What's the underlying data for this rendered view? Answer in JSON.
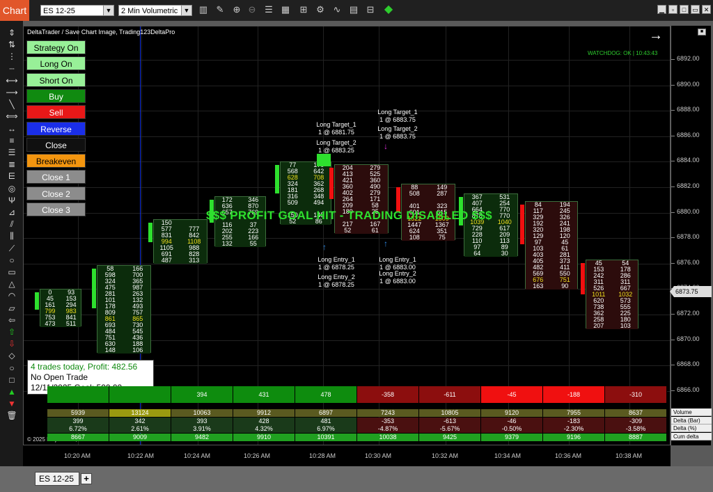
{
  "titlebar": {
    "tab_label": "Chart",
    "instrument": "ES 12-25",
    "period": "2 Min Volumetric",
    "toolbar_icons": [
      "bars-icon",
      "pencil-icon",
      "zoom-in-icon",
      "zoom-out-icon",
      "properties-icon",
      "data-box-icon",
      "templates-icon",
      "strategy-icon",
      "indicators-icon",
      "calendar-icon",
      "chart-trader-icon"
    ],
    "window_buttons": [
      "minimize-icon",
      "maximize-icon",
      "close-icon"
    ]
  },
  "chart": {
    "header": "DeltaTrader / Save Chart Image, Trading123DeltaPro",
    "watchdog": "WATCHDOG: OK | 10:43:43",
    "banner": "$$$ PROFIT GOAL HIT - TRADING DISABLED $$$",
    "copyright": "© 2025 NinjaTrader, LLC",
    "info_box": {
      "line1": "4 trades today, Profit: 482.56",
      "line2": "No Open Trade",
      "line3": "12/11/2025 Goal: 500.00"
    },
    "strategy_buttons": [
      {
        "label": "Strategy On",
        "bg": "#98f098"
      },
      {
        "label": "Long On",
        "bg": "#98f098"
      },
      {
        "label": "Short On",
        "bg": "#98f098"
      },
      {
        "label": "Buy",
        "bg": "#108a10"
      },
      {
        "label": "Sell",
        "bg": "#e81818"
      },
      {
        "label": "Reverse",
        "bg": "#1a2ee8"
      },
      {
        "label": "Close",
        "bg": "#101010"
      },
      {
        "label": "Breakeven",
        "bg": "#f3950f"
      },
      {
        "label": "Close 1",
        "bg": "#8c8c8c"
      },
      {
        "label": "Close 2",
        "bg": "#8c8c8c"
      },
      {
        "label": "Close 3",
        "bg": "#8c8c8c"
      }
    ],
    "orders": [
      {
        "l1": "Long Target_1",
        "l2": "1 @ 6881.75"
      },
      {
        "l1": "Long Target_2",
        "l2": "1 @ 6883.25"
      },
      {
        "l1": "Long Entry_1",
        "l2": "1 @ 6878.25"
      },
      {
        "l1": "Long Entry_2",
        "l2": "1 @ 6878.25"
      },
      {
        "l1": "Long Target_1",
        "l2": "1 @ 6883.75"
      },
      {
        "l1": "Long Target_2",
        "l2": "1 @ 6883.75"
      },
      {
        "l1": "Long Entry_1",
        "l2": "1 @ 6883.00"
      },
      {
        "l1": "Long Entry_2",
        "l2": "1 @ 6883.00"
      }
    ]
  },
  "price_axis": {
    "ticks": [
      "6892.00",
      "6890.00",
      "6888.00",
      "6886.00",
      "6884.00",
      "6882.00",
      "6880.00",
      "6878.00",
      "6876.00",
      "6874.00",
      "6872.00",
      "6870.00",
      "6868.00",
      "6866.00"
    ],
    "current_price": "6873.75"
  },
  "time_axis": [
    "10:20 AM",
    "10:22 AM",
    "10:24 AM",
    "10:26 AM",
    "10:28 AM",
    "10:30 AM",
    "10:32 AM",
    "10:34 AM",
    "10:36 AM",
    "10:38 AM"
  ],
  "candles": [
    {
      "bull": true,
      "rows": [
        [
          "0",
          "93"
        ],
        [
          "45",
          "153"
        ],
        [
          "161",
          "294"
        ],
        [
          "799",
          "983"
        ],
        [
          "753",
          "841"
        ],
        [
          "473",
          "511"
        ]
      ],
      "poc": 3
    },
    {
      "bull": true,
      "rows": [
        [
          "58",
          "166"
        ],
        [
          "598",
          "700"
        ],
        [
          "324",
          "365"
        ],
        [
          "475",
          "987"
        ],
        [
          "281",
          "263"
        ],
        [
          "101",
          "132"
        ],
        [
          "178",
          "493"
        ],
        [
          "809",
          "757"
        ],
        [
          "861",
          "865"
        ],
        [
          "693",
          "730"
        ],
        [
          "484",
          "545"
        ],
        [
          "751",
          "436"
        ],
        [
          "630",
          "188"
        ],
        [
          "148",
          "106"
        ]
      ],
      "poc": 8
    },
    {
      "bull": true,
      "rows": [
        [
          "150",
          ""
        ],
        [
          "577",
          "777"
        ],
        [
          "831",
          "842"
        ],
        [
          "994",
          "1108"
        ],
        [
          "1105",
          "988"
        ],
        [
          "691",
          "828"
        ],
        [
          "487",
          "313"
        ]
      ],
      "poc": 3
    },
    {
      "bull": true,
      "rows": [
        [
          "172",
          "346"
        ],
        [
          "636",
          "870"
        ],
        [
          "657",
          "769"
        ],
        [
          "",
          ""
        ],
        [
          "116",
          "37"
        ],
        [
          "202",
          "223"
        ],
        [
          "255",
          "166"
        ],
        [
          "132",
          "55"
        ]
      ],
      "poc": -1
    },
    {
      "bull": true,
      "rows": [
        [
          "77",
          "170"
        ],
        [
          "568",
          "642"
        ],
        [
          "628",
          "708"
        ],
        [
          "324",
          "362"
        ],
        [
          "181",
          "268"
        ],
        [
          "316",
          "348"
        ],
        [
          "509",
          "494"
        ],
        [
          "",
          ""
        ],
        [
          "150",
          "145"
        ],
        [
          "52",
          "86"
        ]
      ],
      "poc": 2
    },
    {
      "bull": false,
      "rows": [
        [
          "204",
          "279"
        ],
        [
          "413",
          "525"
        ],
        [
          "421",
          "360"
        ],
        [
          "360",
          "490"
        ],
        [
          "402",
          "279"
        ],
        [
          "264",
          "171"
        ],
        [
          "209",
          "58"
        ],
        [
          "189",
          "25"
        ],
        [
          "",
          ""
        ],
        [
          "217",
          "167"
        ],
        [
          "52",
          "61"
        ]
      ],
      "poc": -1
    },
    {
      "bull": false,
      "rows": [
        [
          "88",
          "149"
        ],
        [
          "508",
          "287"
        ],
        [
          "",
          ""
        ],
        [
          "401",
          "323"
        ],
        [
          "601",
          "615"
        ],
        [
          "1522",
          "1509"
        ],
        [
          "1447",
          "1367"
        ],
        [
          "624",
          "351"
        ],
        [
          "108",
          "75"
        ]
      ],
      "poc": 5
    },
    {
      "bull": true,
      "rows": [
        [
          "367",
          "531"
        ],
        [
          "407",
          "254"
        ],
        [
          "664",
          "770"
        ],
        [
          "878",
          "770"
        ],
        [
          "1039",
          "1040"
        ],
        [
          "729",
          "617"
        ],
        [
          "228",
          "209"
        ],
        [
          "110",
          "113"
        ],
        [
          "97",
          "89"
        ],
        [
          "64",
          "30"
        ]
      ],
      "poc": 4
    },
    {
      "bull": false,
      "rows": [
        [
          "84",
          "194"
        ],
        [
          "117",
          "245"
        ],
        [
          "329",
          "326"
        ],
        [
          "192",
          "241"
        ],
        [
          "320",
          "198"
        ],
        [
          "129",
          "120"
        ],
        [
          "97",
          "45"
        ],
        [
          "103",
          "61"
        ],
        [
          "403",
          "281"
        ],
        [
          "405",
          "373"
        ],
        [
          "482",
          "411"
        ],
        [
          "569",
          "550"
        ],
        [
          "676",
          "751"
        ],
        [
          "163",
          "90"
        ]
      ],
      "poc": 12
    },
    {
      "bull": false,
      "rows": [
        [
          "45",
          "54"
        ],
        [
          "153",
          "178"
        ],
        [
          "242",
          "286"
        ],
        [
          "311",
          "311"
        ],
        [
          "526",
          "667"
        ],
        [
          "1011",
          "1032"
        ],
        [
          "620",
          "573"
        ],
        [
          "738",
          "555"
        ],
        [
          "362",
          "225"
        ],
        [
          "258",
          "180"
        ],
        [
          "207",
          "103"
        ]
      ],
      "poc": 5
    }
  ],
  "summary_bar": [
    {
      "value": "",
      "color": "#0e8c0e"
    },
    {
      "value": "",
      "color": "#0e8c0e"
    },
    {
      "value": "394",
      "color": "#0e8c0e"
    },
    {
      "value": "431",
      "color": "#0e8c0e"
    },
    {
      "value": "478",
      "color": "#0e8c0e"
    },
    {
      "value": "-358",
      "color": "#8c0e0e"
    },
    {
      "value": "-611",
      "color": "#8c0e0e"
    },
    {
      "value": "-45",
      "color": "#f01010"
    },
    {
      "value": "-188",
      "color": "#f01010"
    },
    {
      "value": "-310",
      "color": "#8c0e0e"
    }
  ],
  "stats": {
    "labels": [
      "Volume",
      "Delta (Bar)",
      "Delta (%)",
      "Cum delta"
    ],
    "volume": [
      "5939",
      "13124",
      "10063",
      "9912",
      "6897",
      "7243",
      "10805",
      "9120",
      "7955",
      "8637"
    ],
    "delta_bar": [
      "399",
      "342",
      "393",
      "428",
      "481",
      "-353",
      "-613",
      "-46",
      "-183",
      "-309"
    ],
    "delta_pct": [
      "6.72%",
      "2.61%",
      "3.91%",
      "4.32%",
      "6.97%",
      "-4.87%",
      "-5.67%",
      "-0.50%",
      "-2.30%",
      "-3.58%"
    ],
    "cum_delta": [
      "8667",
      "9009",
      "9482",
      "9910",
      "10391",
      "10038",
      "9425",
      "9379",
      "9196",
      "8887"
    ]
  },
  "bottom_tab": "ES 12-25",
  "add_tab": "+"
}
